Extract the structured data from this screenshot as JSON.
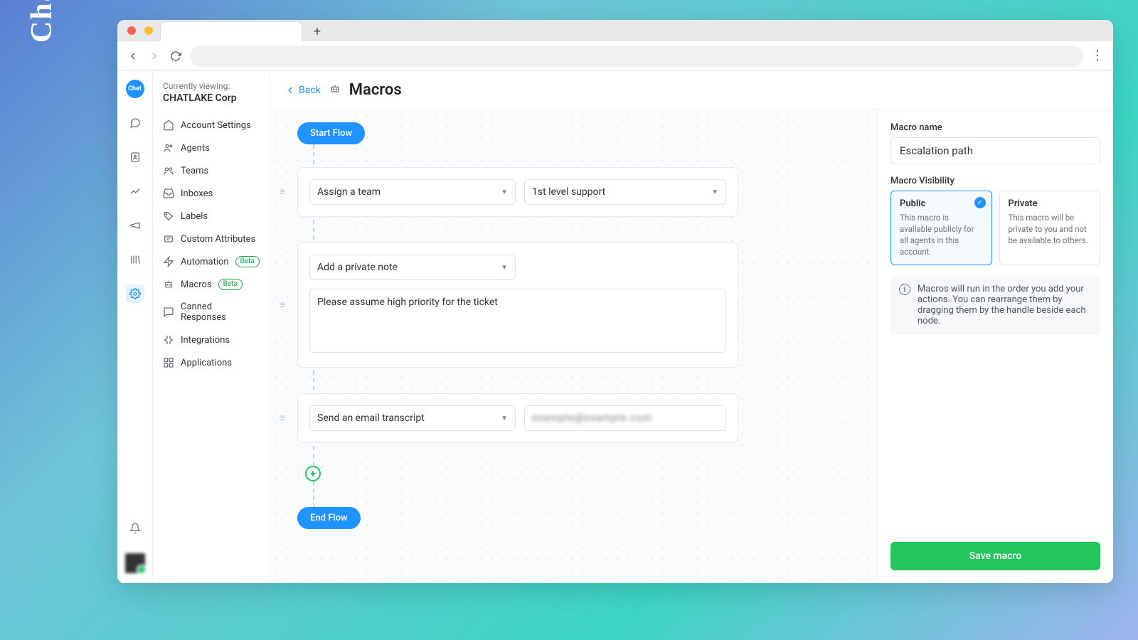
{
  "brand": "Chatlake",
  "browser": {
    "new_tab_label": "+"
  },
  "rail": {
    "logo_text": "Chat",
    "icons": [
      "chat",
      "contacts",
      "reports",
      "campaigns",
      "library",
      "settings"
    ]
  },
  "sidebar": {
    "viewing_label": "Currently viewing:",
    "org_name": "CHATLAKE Corp",
    "items": [
      {
        "label": "Account Settings",
        "icon": "home"
      },
      {
        "label": "Agents",
        "icon": "users"
      },
      {
        "label": "Teams",
        "icon": "team"
      },
      {
        "label": "Inboxes",
        "icon": "inbox"
      },
      {
        "label": "Labels",
        "icon": "tag"
      },
      {
        "label": "Custom Attributes",
        "icon": "attr"
      },
      {
        "label": "Automation",
        "icon": "bolt",
        "badge": "Beta"
      },
      {
        "label": "Macros",
        "icon": "macro",
        "badge": "Beta"
      },
      {
        "label": "Canned Responses",
        "icon": "canned"
      },
      {
        "label": "Integrations",
        "icon": "integ"
      },
      {
        "label": "Applications",
        "icon": "apps"
      }
    ]
  },
  "header": {
    "back_label": "Back",
    "page_title": "Macros"
  },
  "flow": {
    "start_label": "Start Flow",
    "end_label": "End Flow",
    "nodes": [
      {
        "action": "Assign a team",
        "value": "1st level support"
      },
      {
        "action": "Add a private note",
        "text": "Please assume high priority for the ticket"
      },
      {
        "action": "Send an email transcript",
        "value": "example@example.com"
      }
    ]
  },
  "panel": {
    "name_label": "Macro name",
    "name_value": "Escalation path",
    "visibility_label": "Macro Visibility",
    "public_title": "Public",
    "public_desc": "This macro is available publicly for all agents in this account.",
    "private_title": "Private",
    "private_desc": "This macro will be private to you and not be available to others.",
    "info_text": "Macros will run in the order you add your actions. You can rearrange them by dragging them by the handle beside each node.",
    "save_label": "Save macro"
  }
}
